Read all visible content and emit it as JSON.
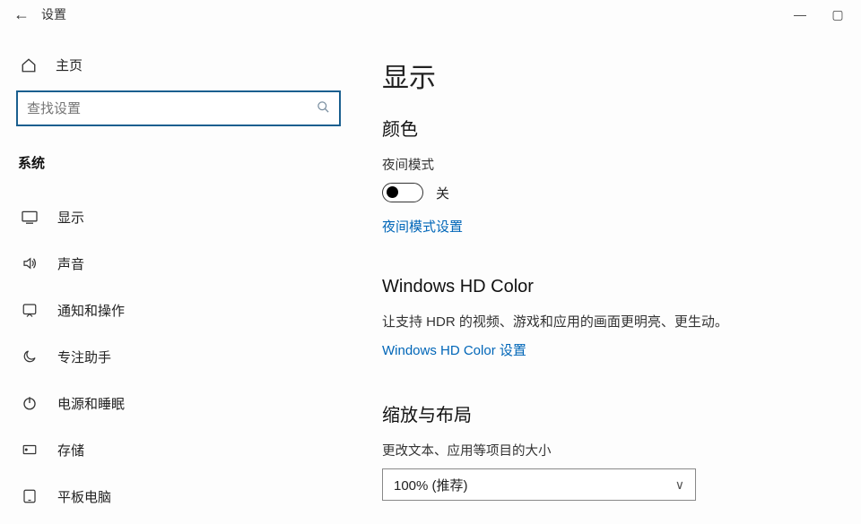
{
  "titlebar": {
    "title": "设置"
  },
  "sidebar": {
    "home": "主页",
    "search_placeholder": "查找设置",
    "category": "系统",
    "items": [
      {
        "label": "显示"
      },
      {
        "label": "声音"
      },
      {
        "label": "通知和操作"
      },
      {
        "label": "专注助手"
      },
      {
        "label": "电源和睡眠"
      },
      {
        "label": "存储"
      },
      {
        "label": "平板电脑"
      }
    ]
  },
  "content": {
    "page_title": "显示",
    "color_heading": "颜色",
    "night_mode_label": "夜间模式",
    "night_mode_off": "关",
    "night_mode_settings_link": "夜间模式设置",
    "hd_heading": "Windows HD Color",
    "hd_desc": "让支持 HDR 的视频、游戏和应用的画面更明亮、更生动。",
    "hd_link": "Windows HD Color 设置",
    "scale_heading": "缩放与布局",
    "scale_label": "更改文本、应用等项目的大小",
    "scale_value": "100% (推荐)"
  }
}
